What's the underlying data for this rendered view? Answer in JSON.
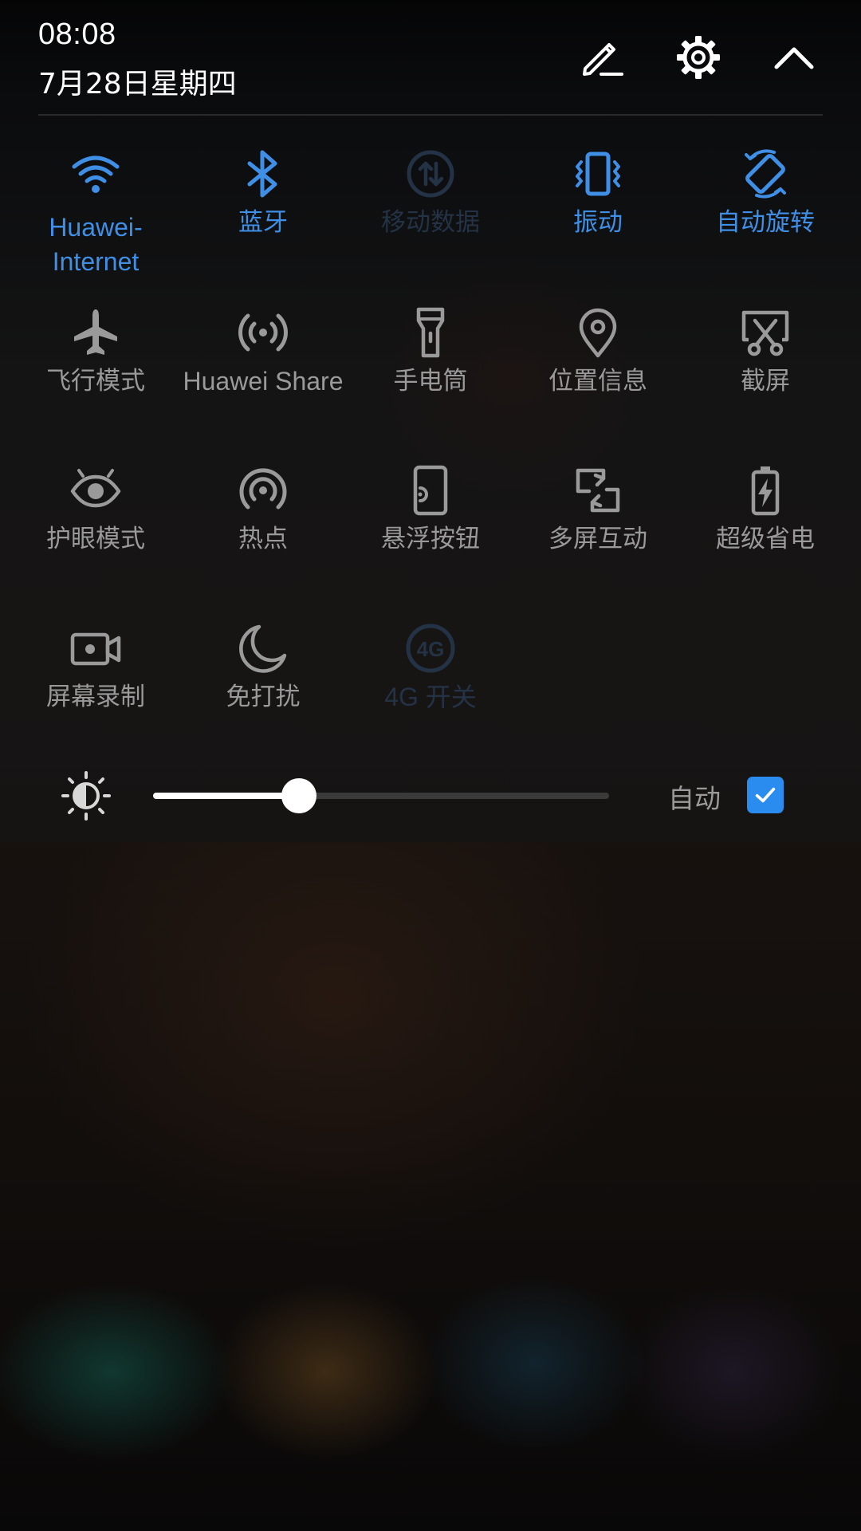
{
  "header": {
    "time": "08:08",
    "date": "7月28日星期四",
    "edit_icon": "pencil-edit-icon",
    "settings_icon": "gear-icon",
    "collapse_icon": "chevron-up-icon"
  },
  "colors": {
    "active": "#3f8fe6",
    "inactive": "#9a9a9a",
    "disabled": "#243246",
    "checkbox": "#2b8cf0"
  },
  "tiles": [
    {
      "label": "Huawei-Internet",
      "icon": "wifi-icon",
      "state": "active"
    },
    {
      "label": "蓝牙",
      "icon": "bluetooth-icon",
      "state": "active"
    },
    {
      "label": "移动数据",
      "icon": "mobile-data-icon",
      "state": "disabled"
    },
    {
      "label": "振动",
      "icon": "vibrate-icon",
      "state": "active"
    },
    {
      "label": "自动旋转",
      "icon": "auto-rotate-icon",
      "state": "active"
    },
    {
      "label": "飞行模式",
      "icon": "airplane-icon",
      "state": "off"
    },
    {
      "label": "Huawei Share",
      "icon": "huawei-share-icon",
      "state": "off"
    },
    {
      "label": "手电筒",
      "icon": "flashlight-icon",
      "state": "off"
    },
    {
      "label": "位置信息",
      "icon": "location-pin-icon",
      "state": "off"
    },
    {
      "label": "截屏",
      "icon": "screenshot-scissors-icon",
      "state": "off"
    },
    {
      "label": "护眼模式",
      "icon": "eye-comfort-icon",
      "state": "off"
    },
    {
      "label": "热点",
      "icon": "hotspot-icon",
      "state": "off"
    },
    {
      "label": "悬浮按钮",
      "icon": "floating-dock-icon",
      "state": "off"
    },
    {
      "label": "多屏互动",
      "icon": "multi-screen-icon",
      "state": "off"
    },
    {
      "label": "超级省电",
      "icon": "battery-saver-icon",
      "state": "off"
    },
    {
      "label": "屏幕录制",
      "icon": "screen-record-icon",
      "state": "off"
    },
    {
      "label": "免打扰",
      "icon": "do-not-disturb-moon-icon",
      "state": "off"
    },
    {
      "label": "4G 开关",
      "icon": "4g-switch-icon",
      "state": "disabled"
    }
  ],
  "brightness": {
    "icon": "brightness-sun-icon",
    "level": 0.32,
    "auto_label": "自动",
    "auto_checked": true
  }
}
